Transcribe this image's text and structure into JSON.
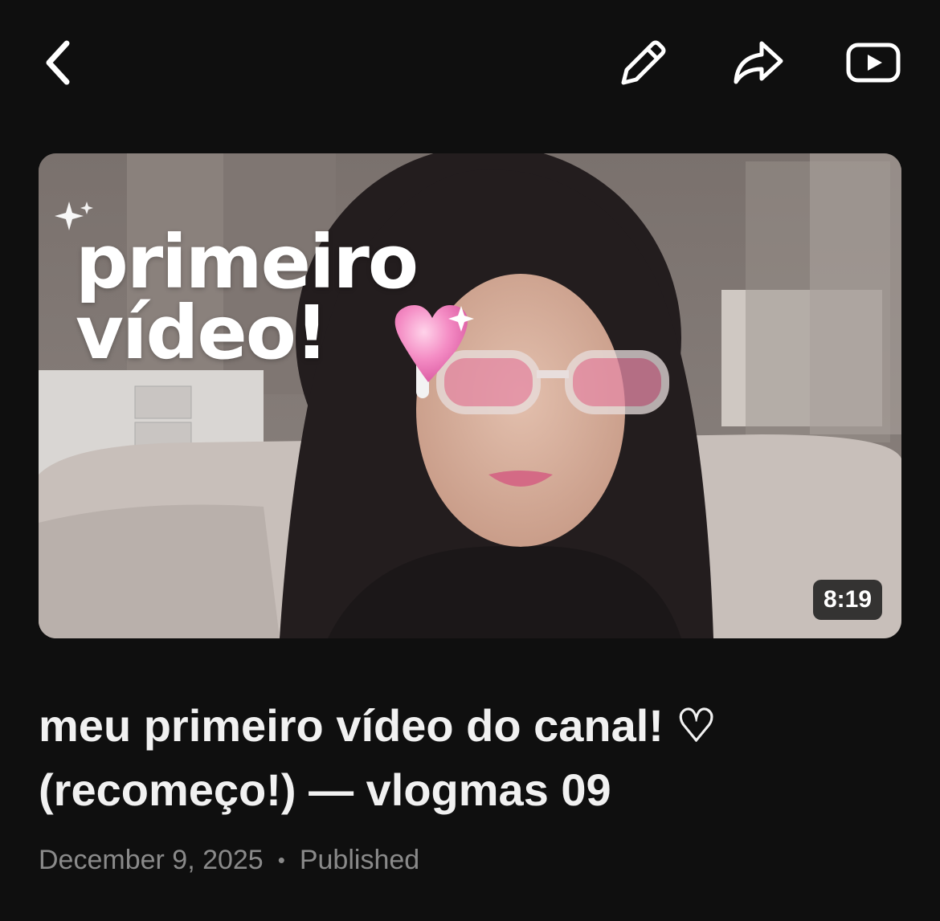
{
  "header": {
    "back_icon": "chevron-left-icon",
    "edit_icon": "pencil-icon",
    "share_icon": "share-arrow-icon",
    "youtube_icon": "youtube-play-icon"
  },
  "video": {
    "thumbnail_text": "primeiro\nvídeo!",
    "duration": "8:19",
    "title": "meu primeiro vídeo do canal! ♡ (recomeço!) — vlogmas 09",
    "date": "December 9, 2025",
    "separator": "•",
    "status": "Published"
  },
  "colors": {
    "background": "#0f0f0f",
    "text": "#f1f1f1",
    "muted": "#8a8a8a"
  }
}
